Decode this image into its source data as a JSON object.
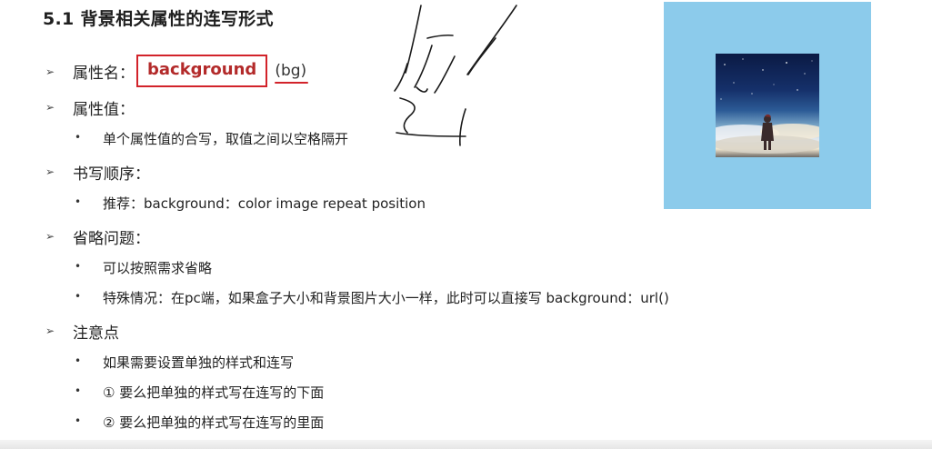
{
  "title": "5.1 背景相关属性的连写形式",
  "property_name": {
    "label": "属性名：",
    "highlight": "background",
    "abbr": "(bg)"
  },
  "property_value": {
    "label": "属性值：",
    "items": [
      "单个属性值的合写，取值之间以空格隔开"
    ]
  },
  "write_order": {
    "label": "书写顺序：",
    "items": [
      "推荐：background：color image repeat position"
    ]
  },
  "omission": {
    "label": "省略问题：",
    "items": [
      "可以按照需求省略",
      "特殊情况：在pc端，如果盒子大小和背景图片大小一样，此时可以直接写 background：url()"
    ]
  },
  "notes": {
    "label": "注意点",
    "items": [
      "如果需要设置单独的样式和连写",
      "① 要么把单独的样式写在连写的下面",
      "② 要么把单独的样式写在连写的里面"
    ]
  },
  "colors": {
    "accent_red": "#d2232a",
    "panel_blue": "#8ccbeb"
  },
  "icons": {
    "level1_bullet": "arrow-bullet-icon",
    "level2_bullet": "dot-bullet-icon"
  }
}
